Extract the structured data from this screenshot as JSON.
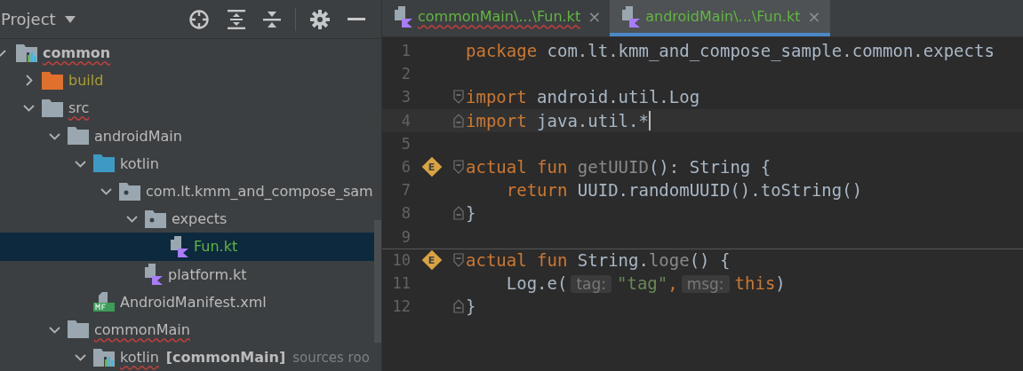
{
  "project_panel": {
    "title": "Project",
    "tree": [
      {
        "name": "common",
        "kind": "module",
        "bold": true,
        "typo": true,
        "modified": false,
        "selected": false,
        "expanded": true,
        "children": [
          {
            "name": "build",
            "kind": "excluded-folder",
            "typo": false,
            "modified": false,
            "selected": false,
            "expanded": false
          },
          {
            "name": "src",
            "kind": "folder",
            "typo": true,
            "modified": false,
            "selected": false,
            "expanded": true,
            "children": [
              {
                "name": "androidMain",
                "kind": "folder",
                "typo": false,
                "modified": false,
                "selected": false,
                "expanded": true,
                "children": [
                  {
                    "name": "kotlin",
                    "kind": "source-folder",
                    "typo": false,
                    "modified": false,
                    "selected": false,
                    "expanded": true,
                    "children": [
                      {
                        "name": "com.lt.kmm_and_compose_sam",
                        "kind": "package",
                        "typo": false,
                        "modified": false,
                        "selected": false,
                        "expanded": true,
                        "children": [
                          {
                            "name": "expects",
                            "kind": "package",
                            "typo": false,
                            "modified": false,
                            "selected": false,
                            "expanded": true,
                            "children": [
                              {
                                "name": "Fun.kt",
                                "kind": "kotlin-file",
                                "typo": false,
                                "modified": true,
                                "selected": true
                              }
                            ]
                          },
                          {
                            "name": "platform.kt",
                            "kind": "kotlin-file",
                            "typo": false,
                            "modified": false,
                            "selected": false
                          }
                        ]
                      }
                    ]
                  },
                  {
                    "name": "AndroidManifest.xml",
                    "kind": "manifest",
                    "typo": false,
                    "modified": false,
                    "selected": false
                  }
                ]
              },
              {
                "name": "commonMain",
                "kind": "folder",
                "typo": true,
                "modified": false,
                "selected": false,
                "expanded": true,
                "children": [
                  {
                    "name": "kotlin",
                    "suffix": "[commonMain]",
                    "hint": "sources roo",
                    "kind": "module-source",
                    "typo": true,
                    "modified": false,
                    "selected": false,
                    "expanded": true
                  }
                ]
              }
            ]
          }
        ]
      }
    ]
  },
  "editor": {
    "tabs": [
      {
        "label": "commonMain\\...\\Fun.kt",
        "selected": false,
        "typo": true,
        "close": "×"
      },
      {
        "label": "androidMain\\...\\Fun.kt",
        "selected": true,
        "typo": false,
        "close": "×"
      }
    ],
    "lines": [
      {
        "number": "1",
        "current": false,
        "separator": false,
        "fold_start": false,
        "fold_end": false,
        "tokens": [
          {
            "kind": "keyword",
            "text": "package"
          },
          {
            "kind": "plain",
            "text": " com.lt.kmm_and_compose_sample.common.expects"
          }
        ]
      },
      {
        "number": "2",
        "current": false,
        "separator": false,
        "fold_start": false,
        "fold_end": false
      },
      {
        "number": "3",
        "current": false,
        "separator": false,
        "fold_start": true,
        "fold_end": false,
        "tokens": [
          {
            "kind": "keyword",
            "text": "import"
          },
          {
            "kind": "plain",
            "text": " android.util.Log"
          }
        ]
      },
      {
        "number": "4",
        "current": true,
        "separator": false,
        "fold_start": false,
        "fold_end": true,
        "tokens": [
          {
            "kind": "keyword",
            "text": "import"
          },
          {
            "kind": "plain",
            "text": " java.util.*"
          }
        ]
      },
      {
        "number": "5",
        "current": false,
        "separator": false,
        "fold_start": false,
        "fold_end": false
      },
      {
        "number": "6",
        "current": false,
        "separator": false,
        "fold_start": true,
        "fold_end": false,
        "marker": "E",
        "tokens": [
          {
            "kind": "keyword",
            "text": "actual fun"
          },
          {
            "kind": "unused",
            "text": " getUUID"
          },
          {
            "kind": "plain",
            "text": "(): String {"
          }
        ]
      },
      {
        "number": "7",
        "current": false,
        "separator": false,
        "fold_start": false,
        "fold_end": false,
        "tokens": [
          {
            "kind": "keyword",
            "text": "    return"
          },
          {
            "kind": "plain",
            "text": " UUID.randomUUID().toString()"
          }
        ]
      },
      {
        "number": "8",
        "current": false,
        "separator": false,
        "fold_start": false,
        "fold_end": true,
        "tokens": [
          {
            "kind": "plain",
            "text": "}"
          }
        ]
      },
      {
        "number": "9",
        "current": false,
        "separator": false,
        "fold_start": false,
        "fold_end": false
      },
      {
        "number": "10",
        "current": false,
        "separator": true,
        "fold_start": true,
        "fold_end": false,
        "marker": "E",
        "tokens": [
          {
            "kind": "keyword",
            "text": "actual fun"
          },
          {
            "kind": "plain",
            "text": " String."
          },
          {
            "kind": "unused",
            "text": "loge"
          },
          {
            "kind": "plain",
            "text": "() {"
          }
        ]
      },
      {
        "number": "11",
        "current": false,
        "separator": false,
        "fold_start": false,
        "fold_end": false,
        "tokens": [
          {
            "kind": "plain",
            "text": "    Log.e("
          },
          {
            "kind": "hint",
            "text": "tag:"
          },
          {
            "kind": "string",
            "text": "\"tag\""
          },
          {
            "kind": "keyword",
            "text": ","
          },
          {
            "kind": "hint",
            "text": "msg:"
          },
          {
            "kind": "keyword",
            "text": "this"
          },
          {
            "kind": "plain",
            "text": ")"
          }
        ]
      },
      {
        "number": "12",
        "current": false,
        "separator": false,
        "fold_start": false,
        "fold_end": true,
        "tokens": [
          {
            "kind": "plain",
            "text": "}"
          }
        ]
      }
    ]
  }
}
